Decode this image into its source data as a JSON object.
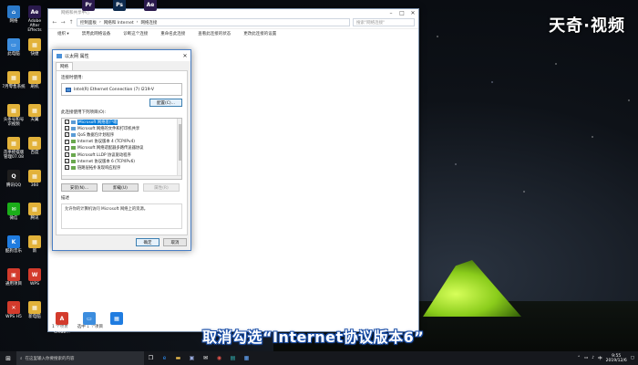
{
  "brand": "天奇·视频",
  "desktop_left": [
    {
      "label": "网络",
      "color": "#2b79c9",
      "glyph": "⌂"
    },
    {
      "label": "此电脑",
      "color": "#3c8dde",
      "glyph": "▭"
    },
    {
      "label": "7月零售系统",
      "color": "#e2b23a",
      "glyph": "▦"
    },
    {
      "label": "头条号和号 识视频",
      "color": "#e2b23a",
      "glyph": "▦"
    },
    {
      "label": "花季摇摆版 管理07.08",
      "color": "#e2b23a",
      "glyph": "▦"
    },
    {
      "label": "腾讯QQ",
      "color": "#1e1e1e",
      "glyph": "Q"
    },
    {
      "label": "微信",
      "color": "#1aad19",
      "glyph": "✉"
    },
    {
      "label": "酷狗音乐",
      "color": "#1f7ce0",
      "glyph": "K"
    },
    {
      "label": "通用项目",
      "color": "#d33b2c",
      "glyph": "▣"
    },
    {
      "label": "WPS H5",
      "color": "#d33b2c",
      "glyph": "✕"
    }
  ],
  "desktop_second": [
    {
      "label": "Adobe After Effects",
      "color": "#2a1a4d",
      "glyph": "Ae"
    },
    {
      "label": "快捷",
      "color": "#e2b23a",
      "glyph": "▦"
    },
    {
      "label": "刷机",
      "color": "#e2b23a",
      "glyph": "▦"
    },
    {
      "label": "天翼",
      "color": "#e2b23a",
      "glyph": "▦"
    },
    {
      "label": "百度",
      "color": "#e2b23a",
      "glyph": "▦"
    },
    {
      "label": "360",
      "color": "#e2b23a",
      "glyph": "▦"
    },
    {
      "label": "腾讯",
      "color": "#e2b23a",
      "glyph": "▦"
    },
    {
      "label": "新",
      "color": "#e2b23a",
      "glyph": "▦"
    },
    {
      "label": "WPS",
      "color": "#d33b2c",
      "glyph": "W"
    },
    {
      "label": "新电脑",
      "color": "#e2b23a",
      "glyph": "▦"
    }
  ],
  "desktop_top": [
    {
      "label": "Pr",
      "color": "#2a1a4d"
    },
    {
      "label": "Ps",
      "color": "#0d2a4d"
    },
    {
      "label": "Ae",
      "color": "#2a1a4d"
    }
  ],
  "bottom_icons": [
    {
      "label": "Adobe Creati...",
      "color": "#d33b2c",
      "glyph": "A"
    },
    {
      "label": "电脑",
      "color": "#3c8dde",
      "glyph": "▭"
    },
    {
      "label": "软件管理",
      "color": "#1f7ce0",
      "glyph": "▦"
    }
  ],
  "explorer": {
    "title": "网络和共享中心",
    "breadcrumb": [
      "控制面板",
      "网络和 Internet",
      "网络连接"
    ],
    "search_placeholder": "搜索\"网络连接\"",
    "commands": [
      "组织 ▾",
      "禁用此网络设备",
      "诊断这个连接",
      "重命名此连接",
      "查看此连接的状态",
      "更改此连接的设置"
    ],
    "status_items": "1 个项目",
    "status_selected": "选中 1 个项目"
  },
  "dialog": {
    "title": "以太网 属性",
    "tab": "网络",
    "connect_using_label": "连接时使用:",
    "adapter": "Intel(R) Ethernet Connection (7) I219-V",
    "configure_button": "配置(C)...",
    "items_label": "此连接使用下列项目(O):",
    "items": [
      {
        "text": "Microsoft 网络客户端",
        "checked": true,
        "selected": true,
        "icon": "b"
      },
      {
        "text": "Microsoft 网络的文件和打印机共享",
        "checked": true,
        "selected": false,
        "icon": "b"
      },
      {
        "text": "QoS 数据包计划程序",
        "checked": true,
        "selected": false,
        "icon": "b"
      },
      {
        "text": "Internet 协议版本 4 (TCP/IPv4)",
        "checked": true,
        "selected": false,
        "icon": "g"
      },
      {
        "text": "Microsoft 网络适配器多路传送器协议",
        "checked": false,
        "selected": false,
        "icon": "g"
      },
      {
        "text": "Microsoft LLDP 协议驱动程序",
        "checked": true,
        "selected": false,
        "icon": "g"
      },
      {
        "text": "Internet 协议版本 6 (TCP/IPv6)",
        "checked": true,
        "selected": false,
        "icon": "g"
      },
      {
        "text": "链路层拓扑发现响应程序",
        "checked": true,
        "selected": false,
        "icon": "g"
      }
    ],
    "install_button": "安装(N)...",
    "uninstall_button": "卸载(U)",
    "properties_button": "属性(R)",
    "description_label": "描述",
    "description_text": "允许你的计算机访问 Microsoft 网络上的资源。",
    "ok_button": "确定",
    "cancel_button": "取消"
  },
  "subtitle": "取消勾选“Internet协议版本6”",
  "taskbar": {
    "search_placeholder": "在这里输入你要搜索的内容",
    "time": "9:55",
    "date": "2019/12/6"
  }
}
